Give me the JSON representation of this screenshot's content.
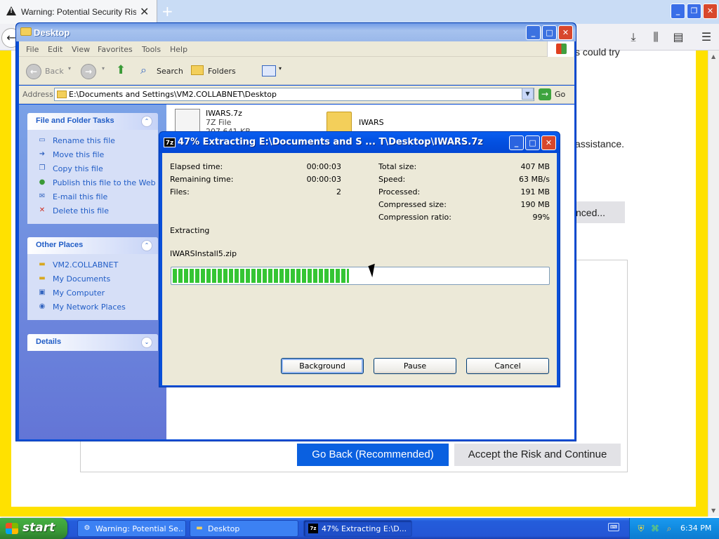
{
  "firefox": {
    "tab_title": "Warning: Potential Security Risk Ahead",
    "partial_text_1": "s could try",
    "partial_text_2": "assistance.",
    "advanced_label": "nced...",
    "go_back_label": "Go Back (Recommended)",
    "accept_label": "Accept the Risk and Continue"
  },
  "explorer": {
    "title": "Desktop",
    "menu": [
      "File",
      "Edit",
      "View",
      "Favorites",
      "Tools",
      "Help"
    ],
    "toolbar": {
      "back": "Back",
      "search": "Search",
      "folders": "Folders"
    },
    "address_label": "Address",
    "address_value": "E:\\Documents and Settings\\VM2.COLLABNET\\Desktop",
    "go_label": "Go",
    "file_tasks": {
      "title": "File and Folder Tasks",
      "items": [
        "Rename this file",
        "Move this file",
        "Copy this file",
        "Publish this file to the Web",
        "E-mail this file",
        "Delete this file"
      ]
    },
    "other_places": {
      "title": "Other Places",
      "items": [
        "VM2.COLLABNET",
        "My Documents",
        "My Computer",
        "My Network Places"
      ]
    },
    "details": {
      "title": "Details"
    },
    "files": [
      {
        "name": "IWARS.7z",
        "type": "7Z File",
        "size": "207,641 KB"
      },
      {
        "name": "IWARS"
      }
    ]
  },
  "sevenzip": {
    "title": "47% Extracting E:\\Documents and S ... T\\Desktop\\IWARS.7z",
    "progress_percent": 47,
    "labels": {
      "elapsed": "Elapsed time:",
      "remaining": "Remaining time:",
      "files": "Files:",
      "total_size": "Total size:",
      "speed": "Speed:",
      "processed": "Processed:",
      "compressed_size": "Compressed size:",
      "compression_ratio": "Compression ratio:"
    },
    "values": {
      "elapsed": "00:00:03",
      "remaining": "00:00:03",
      "files": "2",
      "total_size": "407 MB",
      "speed": "63 MB/s",
      "processed": "191 MB",
      "compressed_size": "190 MB",
      "compression_ratio": "99%"
    },
    "status": "Extracting",
    "current_file": "IWARSInstall5.zip",
    "buttons": {
      "background": "Background",
      "pause": "Pause",
      "cancel": "Cancel"
    }
  },
  "taskbar": {
    "start": "start",
    "items": [
      "Warning: Potential Se...",
      "Desktop",
      "47% Extracting E:\\D..."
    ],
    "clock": "6:34 PM"
  }
}
